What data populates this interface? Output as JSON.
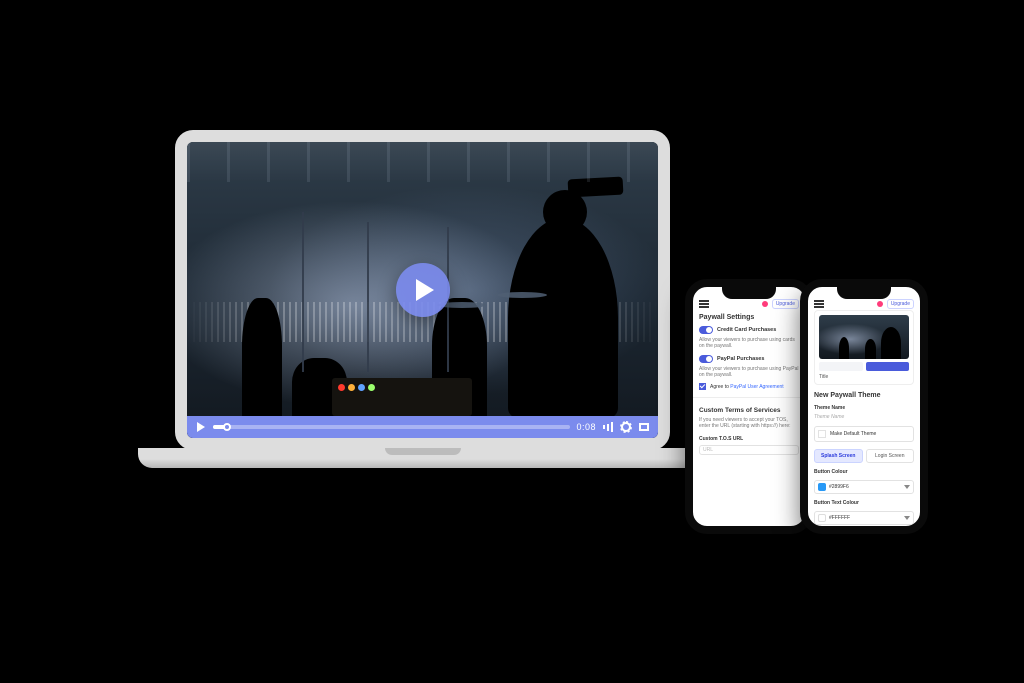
{
  "player": {
    "time": "0:08",
    "progress_pct": 4
  },
  "phoneA": {
    "upgrade": "Upgrade",
    "header": "Paywall Settings",
    "cc_label": "Credit Card Purchases",
    "cc_desc": "Allow your viewers to purchase using cards on the paywall.",
    "pp_label": "PayPal Purchases",
    "pp_desc": "Allow your viewers to purchase using PayPal on the paywall.",
    "agree_prefix": "Agree to",
    "agree_link": "PayPal User Agreement",
    "tos_header": "Custom Terms of Services",
    "tos_desc": "If you need viewers to accept your TOS, enter the URL (starting with https://) here:",
    "tos_field": "Custom T.O.S URL",
    "tos_placeholder": "URL"
  },
  "phoneB": {
    "upgrade": "Upgrade",
    "preview_title": "Title",
    "header": "New Paywall Theme",
    "name_field": "Theme Name",
    "name_hint": "Theme Name",
    "default_label": "Make Default Theme",
    "tab_splash": "Splash Screen",
    "tab_login": "Login Screen",
    "btn_color_label": "Button Colour",
    "btn_color_value": "#2899F6",
    "btn_text_label": "Button Text Colour",
    "btn_text_value": "#FFFFFF"
  },
  "colors": {
    "accent": "#7B8BED",
    "button_swatch": "#2899F6"
  }
}
